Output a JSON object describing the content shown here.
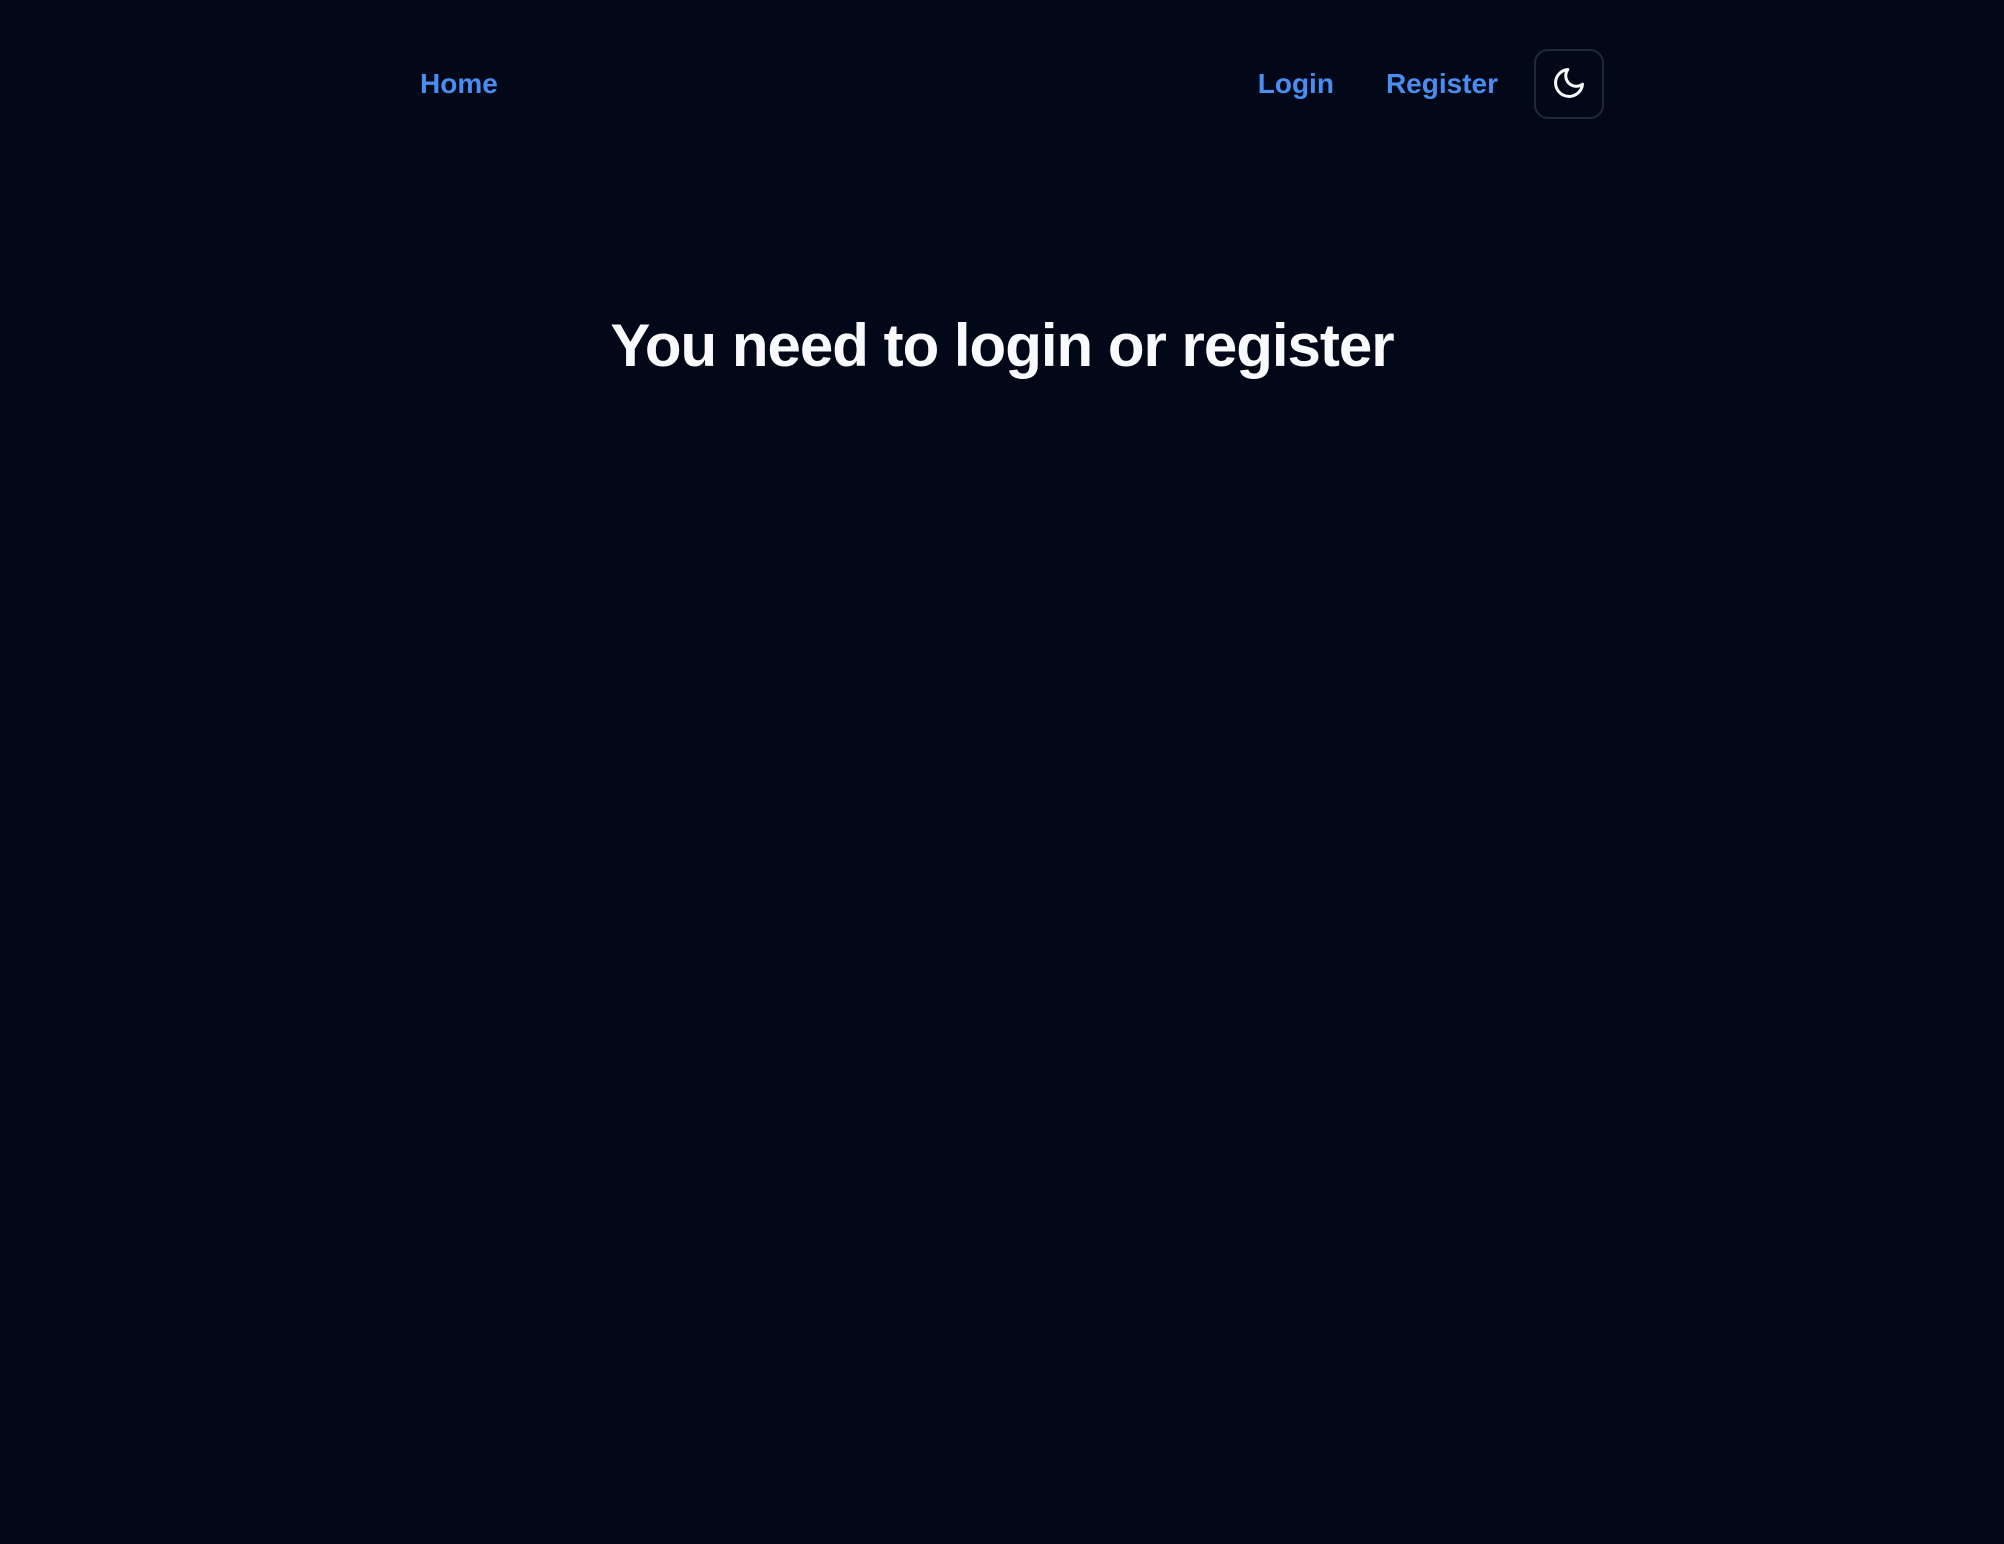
{
  "nav": {
    "home_label": "Home",
    "login_label": "Login",
    "register_label": "Register",
    "theme_toggle_icon": "moon-icon"
  },
  "main": {
    "heading": "You need to login or register"
  },
  "colors": {
    "background": "#020817",
    "link": "#4b8cf0",
    "heading": "#f8fafc",
    "toggle_border": "#1e293b"
  }
}
